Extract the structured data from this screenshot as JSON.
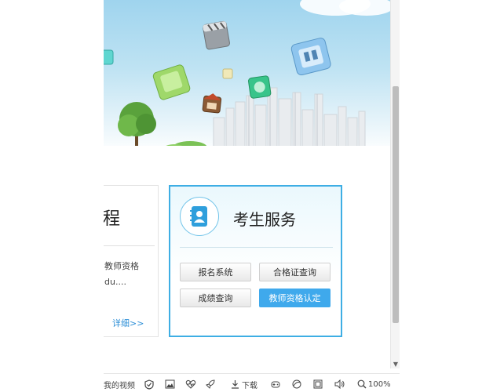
{
  "card_left": {
    "title": "程",
    "line1": "教师资格",
    "line2": "du....",
    "more": "详细>>"
  },
  "card_service": {
    "title": "考生服务",
    "buttons": [
      {
        "label": "报名系统",
        "active": false
      },
      {
        "label": "合格证查询",
        "active": false
      },
      {
        "label": "成绩查询",
        "active": false
      },
      {
        "label": "教师资格认定",
        "active": true
      }
    ]
  },
  "statusbar": {
    "my_videos": "我的视频",
    "download": "下载",
    "zoom": "100%"
  },
  "colors": {
    "accent": "#3eaee4",
    "active_button": "#3fa9ec",
    "link": "#2e8fd7"
  },
  "icons": [
    "shield-icon",
    "image-icon",
    "heart-pulse-icon",
    "rocket-icon",
    "download-icon",
    "game-controller-icon",
    "browser-icon",
    "window-icon",
    "volume-icon",
    "zoom-icon",
    "contact-book-icon"
  ]
}
